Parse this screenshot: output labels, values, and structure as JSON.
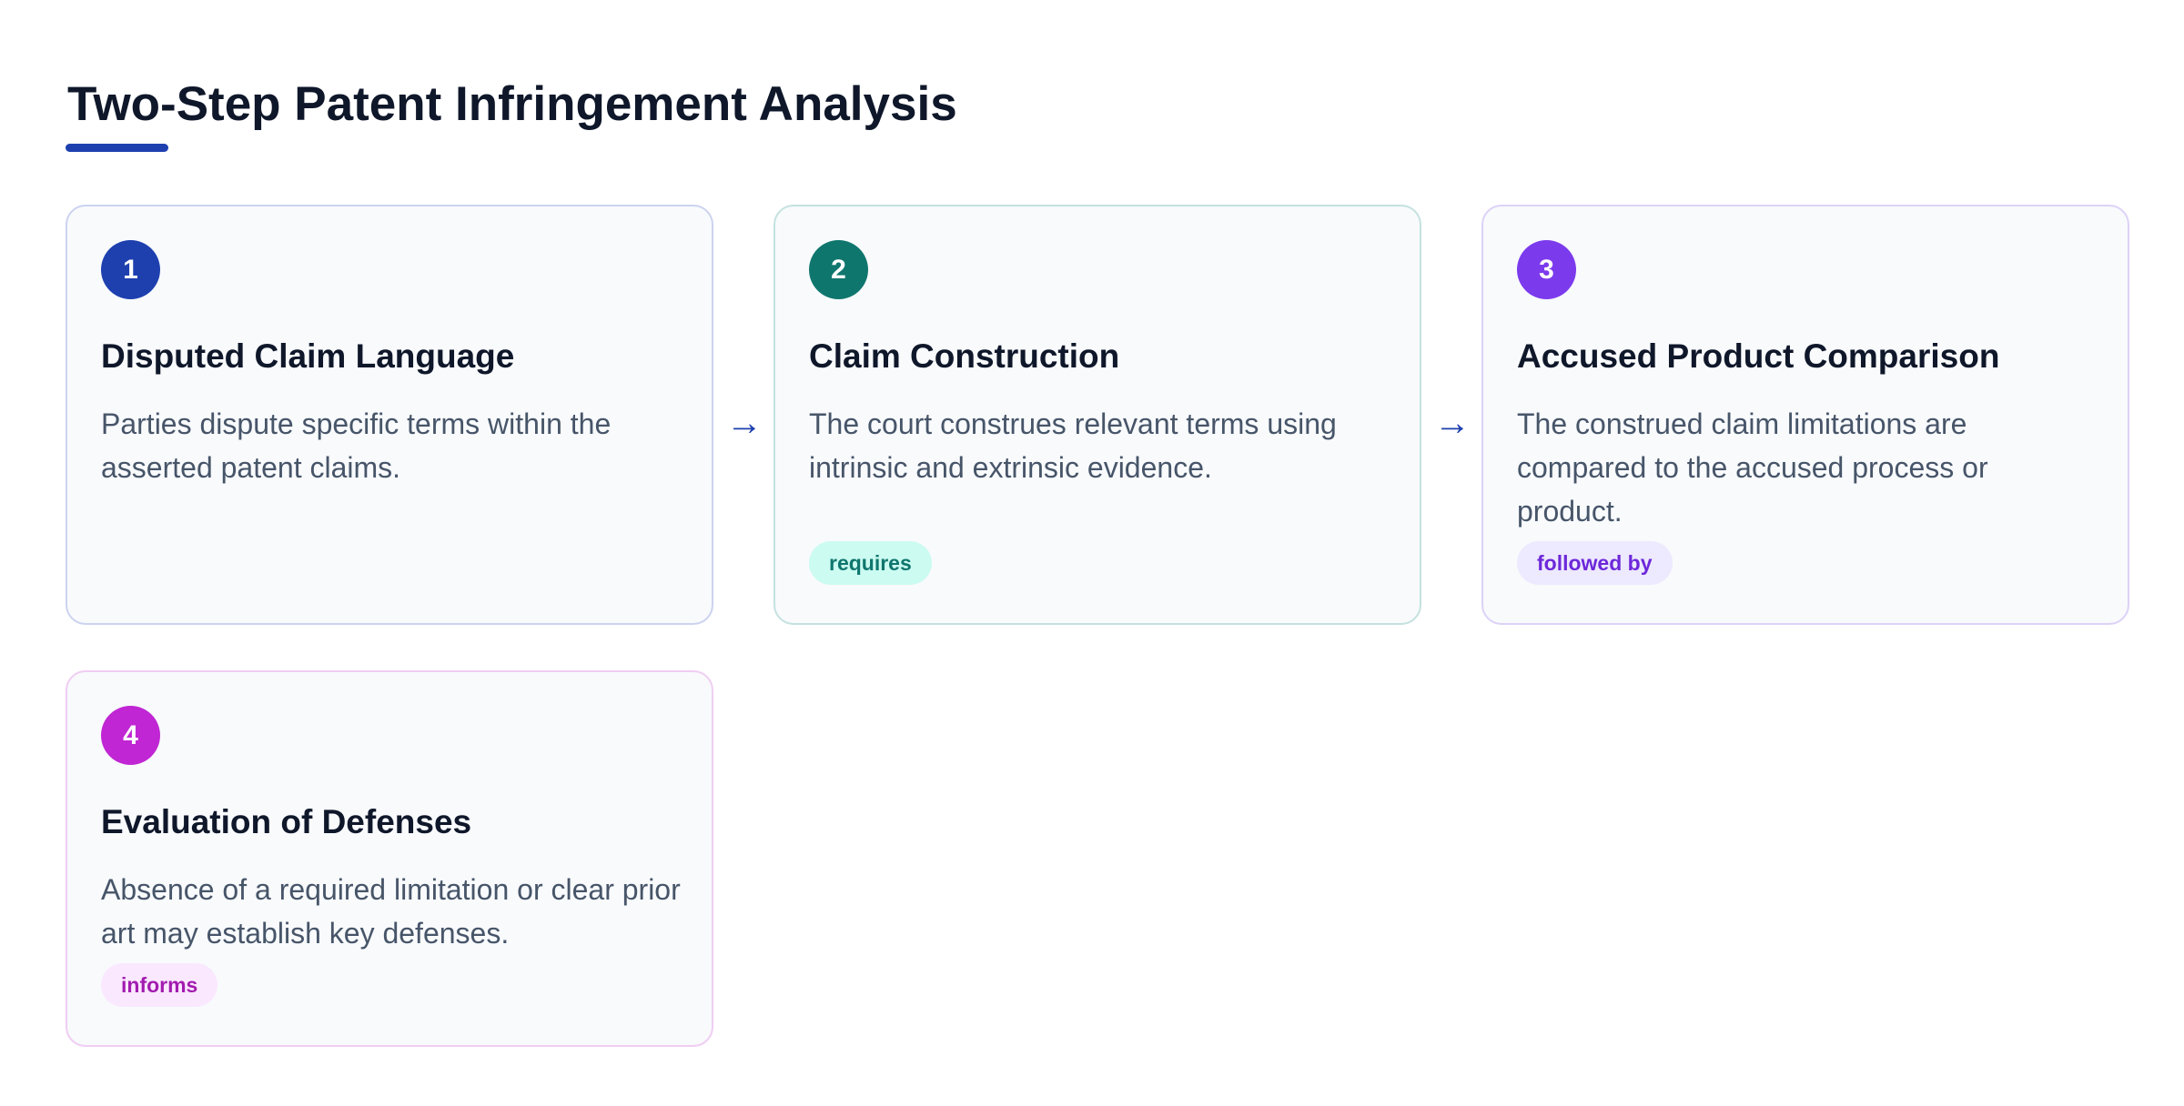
{
  "title": "Two-Step Patent Infringement Analysis",
  "colors": {
    "accent": "#1e40af",
    "step1": "#1e40af",
    "step2": "#0f766e",
    "step3": "#7c3aed",
    "step4": "#c026d3"
  },
  "arrow_glyph": "→",
  "steps": [
    {
      "number": "1",
      "title": "Disputed Claim Language",
      "description": "Parties dispute specific terms within the asserted patent claims."
    },
    {
      "number": "2",
      "title": "Claim Construction",
      "description": "The court construes relevant terms using intrinsic and extrinsic evidence.",
      "tag": "requires"
    },
    {
      "number": "3",
      "title": "Accused Product Comparison",
      "description": "The construed claim limitations are compared to the accused process or product.",
      "tag": "followed by"
    },
    {
      "number": "4",
      "title": "Evaluation of Defenses",
      "description": "Absence of a required limitation or clear prior art may establish key defenses.",
      "tag": "informs"
    }
  ]
}
